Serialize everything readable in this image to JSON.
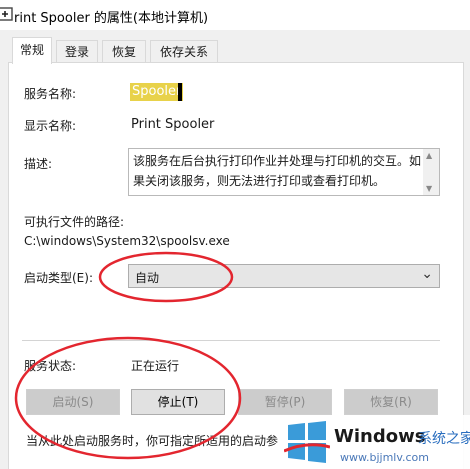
{
  "window": {
    "title": "rint Spooler 的属性(本地计算机)"
  },
  "tabs": [
    {
      "label": "常规"
    },
    {
      "label": "登录"
    },
    {
      "label": "恢复"
    },
    {
      "label": "依存关系"
    }
  ],
  "general": {
    "service_name_label": "服务名称:",
    "service_name_value": "Spooler",
    "display_name_label": "显示名称:",
    "display_name_value": "Print Spooler",
    "description_label": "描述:",
    "description_value": "该服务在后台执行打印作业并处理与打印机的交互。如果关闭该服务，则无法进行打印或查看打印机。",
    "exe_path_label": "可执行文件的路径:",
    "exe_path_value": "C:\\windows\\System32\\spoolsv.exe",
    "startup_type_label": "启动类型(E):",
    "startup_type_value": "自动",
    "service_status_label": "服务状态:",
    "service_status_value": "正在运行"
  },
  "buttons": {
    "start": "启动(S)",
    "stop": "停止(T)",
    "pause": "暂停(P)",
    "resume": "恢复(R)"
  },
  "footer_text": "当从此处启动服务时，你可指定所适用的启动参",
  "watermark": {
    "brand": "Windows",
    "brand_cn": "系统之家",
    "url": "www.bjjmlv.com"
  },
  "colors": {
    "highlight": "#e8d24a",
    "annotation": "#e3262f",
    "panel_bg": "#ffffff",
    "window_bg": "#f0f0f0"
  }
}
